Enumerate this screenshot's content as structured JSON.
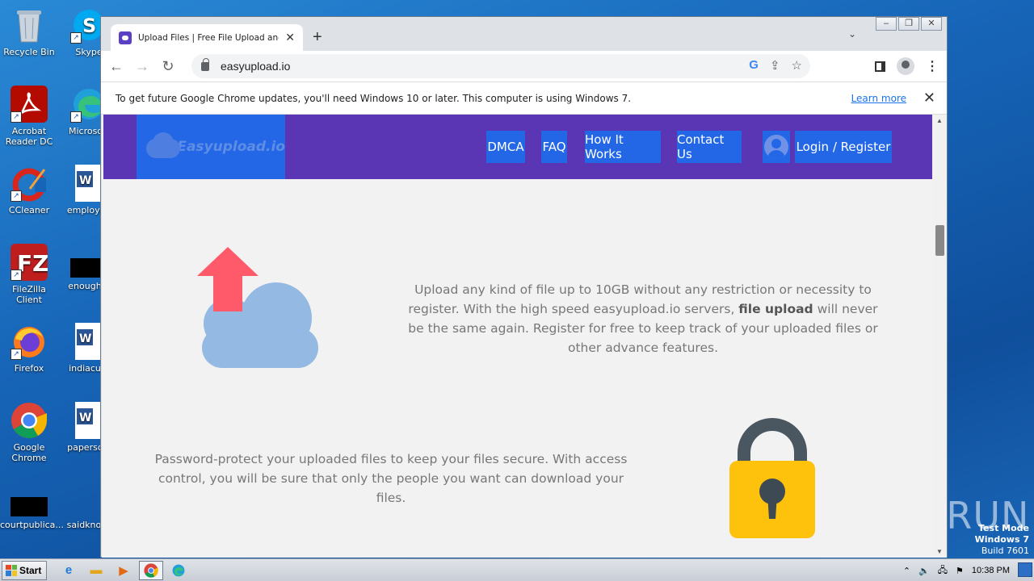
{
  "desktop": {
    "icons": [
      {
        "label": "Recycle Bin"
      },
      {
        "label": "Skype"
      },
      {
        "label": "Acrobat Reader DC"
      },
      {
        "label": "Microsoft"
      },
      {
        "label": "CCleaner"
      },
      {
        "label": "employee"
      },
      {
        "label": "FileZilla Client"
      },
      {
        "label": "enoughst"
      },
      {
        "label": "Firefox"
      },
      {
        "label": "indiacust"
      },
      {
        "label": "Google Chrome"
      },
      {
        "label": "papersclu"
      },
      {
        "label": "courtpublica..."
      },
      {
        "label": "saidknowl"
      }
    ],
    "watermark": "ANY▷RUN",
    "test_mode": {
      "line1": "Test Mode",
      "line2": "Windows 7",
      "line3": "Build 7601"
    }
  },
  "browser": {
    "tab_title": "Upload Files | Free File Upload and T",
    "url": "easyupload.io",
    "infobar": {
      "message": "To get future Google Chrome updates, you'll need Windows 10 or later. This computer is using Windows 7.",
      "link": "Learn more"
    }
  },
  "site": {
    "logo_text": "Easyupload.io",
    "nav": {
      "dmca": "DMCA",
      "faq": "FAQ",
      "how": "How It Works",
      "contact": "Contact Us",
      "login": "Login / Register"
    },
    "feature1": {
      "before": "Upload any kind of file up to 10GB without any restriction or necessity to register. With the high speed easyupload.io servers, ",
      "bold": "file upload",
      "after": " will never be the same again. Register for free to keep track of your uploaded files or other advance features."
    },
    "feature2": "Password-protect your uploaded files to keep your files secure. With access control, you will be sure that only the people you want can download your files."
  },
  "taskbar": {
    "start": "Start",
    "clock": "10:38 PM"
  },
  "colors": {
    "header": "#5b36b4",
    "nav_button": "#2367e6",
    "arrow": "#ff5a6a",
    "cloud": "#94b9e3",
    "lock_body": "#fec20c",
    "lock_shackle": "#4a5660"
  }
}
